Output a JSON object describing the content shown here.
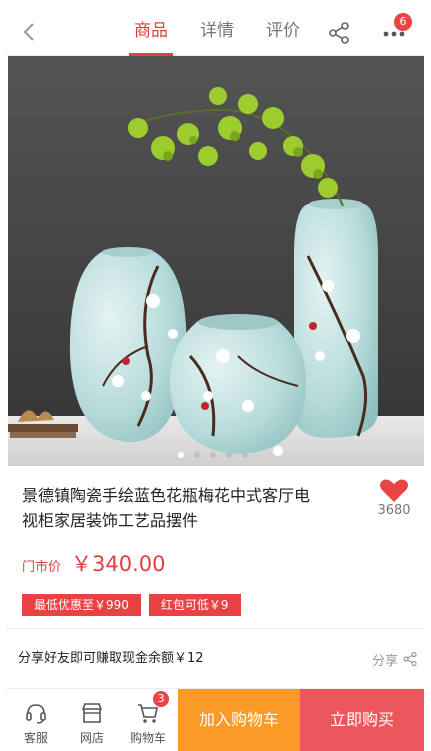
{
  "nav": {
    "tabs": [
      {
        "label": "商品",
        "active": true
      },
      {
        "label": "详情",
        "active": false
      },
      {
        "label": "评价",
        "active": false
      }
    ],
    "more_badge": "6"
  },
  "gallery": {
    "image_count": 5,
    "active_index": 0
  },
  "product": {
    "title": "景德镇陶瓷手绘蓝色花瓶梅花中式客厅电视柜家居装饰工艺品摆件",
    "favorite_count": "3680",
    "price_label": "门市价",
    "price": "￥340.00",
    "tags": [
      "最低优惠至￥990",
      "红包可低￥9"
    ]
  },
  "share": {
    "text": "分享好友即可赚取现金余额￥12",
    "button_label": "分享"
  },
  "bottom": {
    "service_label": "客服",
    "shop_label": "网店",
    "cart_label": "购物车",
    "cart_badge": "3",
    "add_to_cart_label": "加入购物车",
    "buy_now_label": "立即购买"
  },
  "colors": {
    "accent": "#e0403f",
    "add_to_cart": "#fb9a27",
    "buy_now": "#ec575c"
  }
}
